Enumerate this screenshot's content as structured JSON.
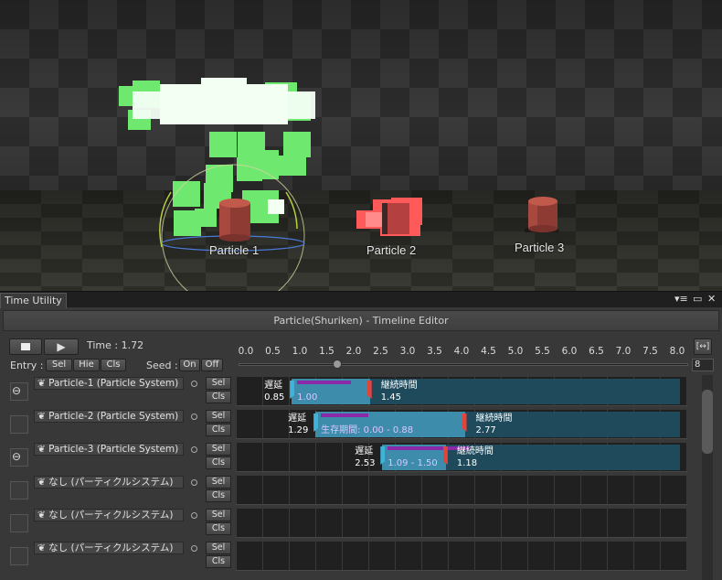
{
  "scene": {
    "particles": [
      {
        "label": "Particle 1"
      },
      {
        "label": "Particle 2"
      },
      {
        "label": "Particle 3"
      }
    ]
  },
  "window": {
    "tab_title": "Time Utility",
    "menu_icon": "menu-icon",
    "maximize_icon": "maximize-icon",
    "close_icon": "close-icon"
  },
  "editor": {
    "title": "Particle(Shuriken) - Timeline Editor",
    "time_label": "Time : 1.72",
    "time_value": 1.72,
    "entry_label": "Entry :",
    "entry_buttons": [
      "Sel",
      "Hie",
      "Cls"
    ],
    "seed_label": "Seed :",
    "seed_buttons": [
      "On",
      "Off"
    ],
    "fit_button": "[↔]",
    "max_field": "8",
    "ruler": [
      "0.0",
      "0.5",
      "1.0",
      "1.5",
      "2.0",
      "2.5",
      "3.0",
      "3.5",
      "4.0",
      "4.5",
      "5.0",
      "5.5",
      "6.0",
      "6.5",
      "7.0",
      "7.5",
      "8.0"
    ]
  },
  "rows": [
    {
      "name": "Particle-1 (Particle System)",
      "linked": true,
      "sel": "Sel",
      "cls": "Cls",
      "delay_label": "遅延",
      "delay": "0.85",
      "lifetime": "1.00",
      "duration_label": "継続時間",
      "duration": "1.45",
      "delay_num": 0.85,
      "duration_num": 1.45,
      "life_num": 1.0
    },
    {
      "name": "Particle-2 (Particle System)",
      "linked": false,
      "sel": "Sel",
      "cls": "Cls",
      "delay_label": "遅延",
      "delay": "1.29",
      "lifetime": "生存期間: 0.00 - 0.88",
      "duration_label": "継続時間",
      "duration": "2.77",
      "delay_num": 1.29,
      "duration_num": 2.77,
      "life_num": 0.88
    },
    {
      "name": "Particle-3 (Particle System)",
      "linked": true,
      "sel": "Sel",
      "cls": "Cls",
      "delay_label": "遅延",
      "delay": "2.53",
      "lifetime": "1.09 - 1.50",
      "duration_label": "継続時間",
      "duration": "1.18",
      "delay_num": 2.53,
      "duration_num": 1.18,
      "life_num": 1.5
    },
    {
      "name": "なし (パーティクルシステム)",
      "linked": false,
      "sel": "Sel",
      "cls": "Cls"
    },
    {
      "name": "なし (パーティクルシステム)",
      "linked": false,
      "sel": "Sel",
      "cls": "Cls"
    },
    {
      "name": "なし (パーティクルシステム)",
      "linked": false,
      "sel": "Sel",
      "cls": "Cls"
    }
  ],
  "colors": {
    "bar": "#3d8cab",
    "bar_dark": "#1e4a5c",
    "delay_marker": "#3fb3d9",
    "end_marker": "#e0443a",
    "lifetime": "#8a2aa8"
  }
}
